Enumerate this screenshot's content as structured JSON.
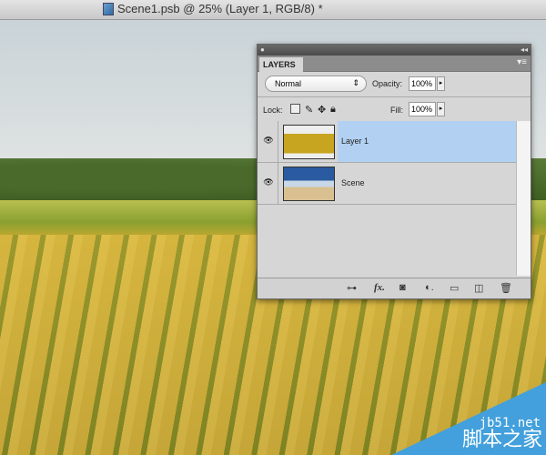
{
  "window": {
    "title": "Scene1.psb @ 25% (Layer 1, RGB/8) *"
  },
  "panel": {
    "tab": "LAYERS",
    "blend_mode": "Normal",
    "opacity_label": "Opacity:",
    "opacity": "100%",
    "lock_label": "Lock:",
    "fill_label": "Fill:",
    "fill": "100%",
    "layers": [
      {
        "name": "Layer 1",
        "selected": true,
        "visible": true
      },
      {
        "name": "Scene",
        "selected": false,
        "visible": true
      }
    ],
    "bottom_icons": [
      "link-layers-icon",
      "fx-icon",
      "add-mask-icon",
      "adjustment-layer-icon",
      "new-group-icon",
      "new-layer-icon",
      "trash-icon"
    ]
  },
  "watermark": {
    "url": "jb51.net",
    "name": "脚本之家"
  },
  "colors": {
    "selection": "#b2d1f2",
    "watermark": "#43a0dc"
  }
}
